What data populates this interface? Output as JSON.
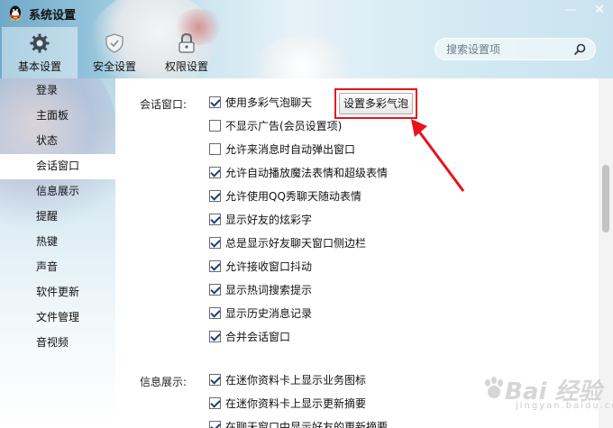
{
  "window": {
    "title": "系统设置",
    "minimize_glyph": "—",
    "close_glyph": "✕"
  },
  "nav_tabs": [
    {
      "label": "基本设置",
      "icon": "gear-icon",
      "active": true
    },
    {
      "label": "安全设置",
      "icon": "shield-icon",
      "active": false
    },
    {
      "label": "权限设置",
      "icon": "lock-icon",
      "active": false
    }
  ],
  "search": {
    "placeholder": "搜索设置项",
    "icon": "search-icon"
  },
  "sidebar": {
    "items": [
      {
        "label": "登录"
      },
      {
        "label": "主面板"
      },
      {
        "label": "状态"
      },
      {
        "label": "会话窗口",
        "active": true
      },
      {
        "label": "信息展示"
      },
      {
        "label": "提醒"
      },
      {
        "label": "热键"
      },
      {
        "label": "声音"
      },
      {
        "label": "软件更新"
      },
      {
        "label": "文件管理"
      },
      {
        "label": "音视频"
      }
    ]
  },
  "session_window": {
    "label": "会话窗口:",
    "bubble_button": "设置多彩气泡",
    "options": [
      {
        "label": "使用多彩气泡聊天",
        "checked": true
      },
      {
        "label": "不显示广告(会员设置项)",
        "checked": false
      },
      {
        "label": "允许来消息时自动弹出窗口",
        "checked": false
      },
      {
        "label": "允许自动播放魔法表情和超级表情",
        "checked": true
      },
      {
        "label": "允许使用QQ秀聊天随动表情",
        "checked": true
      },
      {
        "label": "显示好友的炫彩字",
        "checked": true
      },
      {
        "label": "总是显示好友聊天窗口侧边栏",
        "checked": true
      },
      {
        "label": "允许接收窗口抖动",
        "checked": true
      },
      {
        "label": "显示热词搜索提示",
        "checked": true
      },
      {
        "label": "显示历史消息记录",
        "checked": true
      },
      {
        "label": "合并会话窗口",
        "checked": true
      }
    ]
  },
  "info_display": {
    "label": "信息展示:",
    "options": [
      {
        "label": "在迷你资料卡上显示业务图标",
        "checked": true
      },
      {
        "label": "在迷你资料卡上显示更新摘要",
        "checked": true
      },
      {
        "label": "在聊天窗口中显示好友的更新摘要",
        "checked": true
      }
    ]
  },
  "annotation": {
    "color": "#e8131b"
  },
  "watermark": {
    "text": "Bai 经验",
    "sub": "jingyan.baidu.com"
  },
  "colors": {
    "accent": "#1d3f7a",
    "highlight": "#e8131b"
  }
}
